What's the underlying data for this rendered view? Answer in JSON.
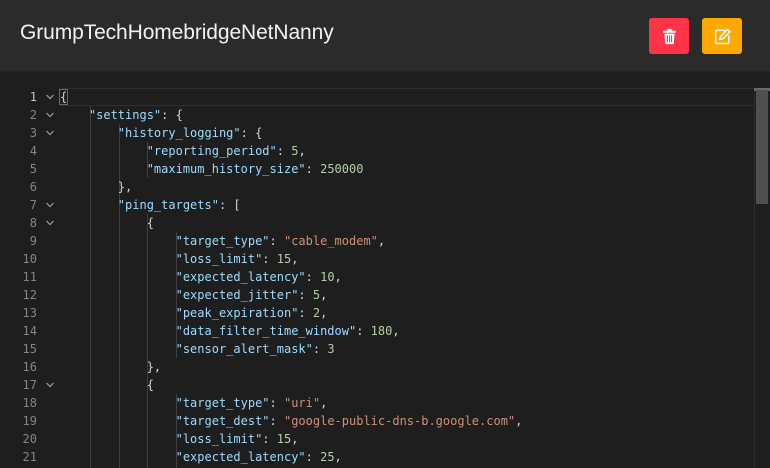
{
  "header": {
    "title": "GrumpTechHomebridgeNetNanny",
    "delete_icon": "trash-icon",
    "edit_icon": "edit-icon",
    "delete_color": "#ff3448",
    "edit_color": "#ffa800"
  },
  "editor": {
    "current_line": 1,
    "lines": [
      {
        "n": "1",
        "fold": true,
        "tokens": [
          {
            "t": "{",
            "c": "pun"
          }
        ]
      },
      {
        "n": "2",
        "fold": true,
        "tokens": [
          {
            "t": "    ",
            "c": "pun"
          },
          {
            "t": "\"settings\"",
            "c": "key"
          },
          {
            "t": ": {",
            "c": "pun"
          }
        ]
      },
      {
        "n": "3",
        "fold": true,
        "tokens": [
          {
            "t": "        ",
            "c": "pun"
          },
          {
            "t": "\"history_logging\"",
            "c": "key"
          },
          {
            "t": ": {",
            "c": "pun"
          }
        ]
      },
      {
        "n": "4",
        "fold": false,
        "tokens": [
          {
            "t": "            ",
            "c": "pun"
          },
          {
            "t": "\"reporting_period\"",
            "c": "key"
          },
          {
            "t": ": ",
            "c": "pun"
          },
          {
            "t": "5",
            "c": "num"
          },
          {
            "t": ",",
            "c": "pun"
          }
        ]
      },
      {
        "n": "5",
        "fold": false,
        "tokens": [
          {
            "t": "            ",
            "c": "pun"
          },
          {
            "t": "\"maximum_history_size\"",
            "c": "key"
          },
          {
            "t": ": ",
            "c": "pun"
          },
          {
            "t": "250000",
            "c": "num"
          }
        ]
      },
      {
        "n": "6",
        "fold": false,
        "tokens": [
          {
            "t": "        },",
            "c": "pun"
          }
        ]
      },
      {
        "n": "7",
        "fold": true,
        "tokens": [
          {
            "t": "        ",
            "c": "pun"
          },
          {
            "t": "\"ping_targets\"",
            "c": "key"
          },
          {
            "t": ": [",
            "c": "pun"
          }
        ]
      },
      {
        "n": "8",
        "fold": true,
        "tokens": [
          {
            "t": "            {",
            "c": "pun"
          }
        ]
      },
      {
        "n": "9",
        "fold": false,
        "tokens": [
          {
            "t": "                ",
            "c": "pun"
          },
          {
            "t": "\"target_type\"",
            "c": "key"
          },
          {
            "t": ": ",
            "c": "pun"
          },
          {
            "t": "\"cable_modem\"",
            "c": "str"
          },
          {
            "t": ",",
            "c": "pun"
          }
        ]
      },
      {
        "n": "10",
        "fold": false,
        "tokens": [
          {
            "t": "                ",
            "c": "pun"
          },
          {
            "t": "\"loss_limit\"",
            "c": "key"
          },
          {
            "t": ": ",
            "c": "pun"
          },
          {
            "t": "15",
            "c": "num"
          },
          {
            "t": ",",
            "c": "pun"
          }
        ]
      },
      {
        "n": "11",
        "fold": false,
        "tokens": [
          {
            "t": "                ",
            "c": "pun"
          },
          {
            "t": "\"expected_latency\"",
            "c": "key"
          },
          {
            "t": ": ",
            "c": "pun"
          },
          {
            "t": "10",
            "c": "num"
          },
          {
            "t": ",",
            "c": "pun"
          }
        ]
      },
      {
        "n": "12",
        "fold": false,
        "tokens": [
          {
            "t": "                ",
            "c": "pun"
          },
          {
            "t": "\"expected_jitter\"",
            "c": "key"
          },
          {
            "t": ": ",
            "c": "pun"
          },
          {
            "t": "5",
            "c": "num"
          },
          {
            "t": ",",
            "c": "pun"
          }
        ]
      },
      {
        "n": "13",
        "fold": false,
        "tokens": [
          {
            "t": "                ",
            "c": "pun"
          },
          {
            "t": "\"peak_expiration\"",
            "c": "key"
          },
          {
            "t": ": ",
            "c": "pun"
          },
          {
            "t": "2",
            "c": "num"
          },
          {
            "t": ",",
            "c": "pun"
          }
        ]
      },
      {
        "n": "14",
        "fold": false,
        "tokens": [
          {
            "t": "                ",
            "c": "pun"
          },
          {
            "t": "\"data_filter_time_window\"",
            "c": "key"
          },
          {
            "t": ": ",
            "c": "pun"
          },
          {
            "t": "180",
            "c": "num"
          },
          {
            "t": ",",
            "c": "pun"
          }
        ]
      },
      {
        "n": "15",
        "fold": false,
        "tokens": [
          {
            "t": "                ",
            "c": "pun"
          },
          {
            "t": "\"sensor_alert_mask\"",
            "c": "key"
          },
          {
            "t": ": ",
            "c": "pun"
          },
          {
            "t": "3",
            "c": "num"
          }
        ]
      },
      {
        "n": "16",
        "fold": false,
        "tokens": [
          {
            "t": "            },",
            "c": "pun"
          }
        ]
      },
      {
        "n": "17",
        "fold": true,
        "tokens": [
          {
            "t": "            {",
            "c": "pun"
          }
        ]
      },
      {
        "n": "18",
        "fold": false,
        "tokens": [
          {
            "t": "                ",
            "c": "pun"
          },
          {
            "t": "\"target_type\"",
            "c": "key"
          },
          {
            "t": ": ",
            "c": "pun"
          },
          {
            "t": "\"uri\"",
            "c": "str"
          },
          {
            "t": ",",
            "c": "pun"
          }
        ]
      },
      {
        "n": "19",
        "fold": false,
        "tokens": [
          {
            "t": "                ",
            "c": "pun"
          },
          {
            "t": "\"target_dest\"",
            "c": "key"
          },
          {
            "t": ": ",
            "c": "pun"
          },
          {
            "t": "\"google-public-dns-b.google.com\"",
            "c": "str"
          },
          {
            "t": ",",
            "c": "pun"
          }
        ]
      },
      {
        "n": "20",
        "fold": false,
        "tokens": [
          {
            "t": "                ",
            "c": "pun"
          },
          {
            "t": "\"loss_limit\"",
            "c": "key"
          },
          {
            "t": ": ",
            "c": "pun"
          },
          {
            "t": "15",
            "c": "num"
          },
          {
            "t": ",",
            "c": "pun"
          }
        ]
      },
      {
        "n": "21",
        "fold": false,
        "tokens": [
          {
            "t": "                ",
            "c": "pun"
          },
          {
            "t": "\"expected_latency\"",
            "c": "key"
          },
          {
            "t": ": ",
            "c": "pun"
          },
          {
            "t": "25",
            "c": "num"
          },
          {
            "t": ",",
            "c": "pun"
          }
        ]
      }
    ]
  }
}
